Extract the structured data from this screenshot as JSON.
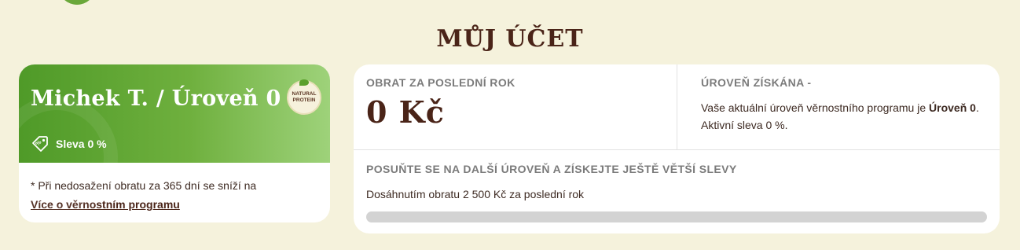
{
  "page": {
    "title": "MŮJ ÚČET"
  },
  "level_card": {
    "name": "Michek T. / Úroveň 0",
    "badge_line1": "NATURAL",
    "badge_line2": "PROTEIN",
    "discount": "Sleva 0 %",
    "note": "* Při nedosažení obratu za 365 dní se sníží na",
    "program_link": "Více o věrnostním programu"
  },
  "stats": {
    "turnover_label": "OBRAT ZA POSLEDNÍ ROK",
    "turnover_value": "0 Kč",
    "level_label": "ÚROVEŇ ZÍSKÁNA -",
    "level_text_prefix": "Vaše aktuální úroveň věrnostního programu je ",
    "level_text_bold": "Úroveň 0",
    "level_text_suffix": ".",
    "active_discount": "Aktivní sleva 0 %.",
    "next_label": "POSUŇTE SE NA DALŠÍ ÚROVEŇ A ZÍSKEJTE JEŠTĚ VĚTŠÍ SLEVY",
    "next_text": "Dosáhnutím obratu 2 500 Kč za poslední rok",
    "progress_fraction": 0
  },
  "icons": {
    "logo": "brand-logo-icon",
    "tag": "discount-tag-icon",
    "badge": "natural-protein-badge-icon"
  },
  "colors": {
    "background": "#f5f2dc",
    "green": "#5a9f2c",
    "brown": "#4a2418",
    "progress_track": "#d3d3d3"
  }
}
